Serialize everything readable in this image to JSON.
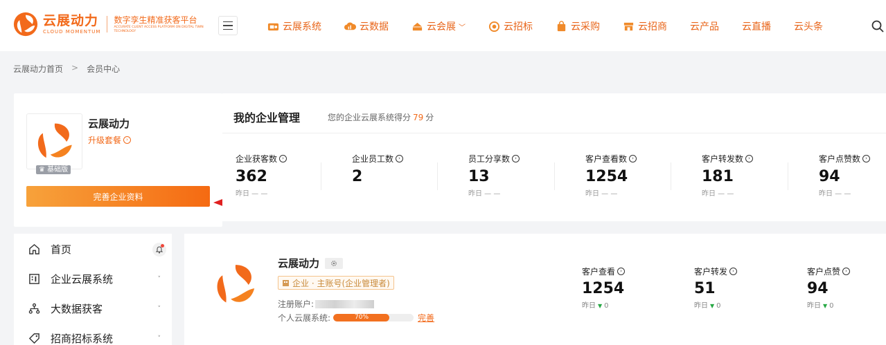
{
  "brand": {
    "name_cn": "云展动力",
    "name_en": "CLOUD MOMENTUM",
    "slogan_cn": "数字孪生精准获客平台",
    "slogan_en": "ACCURATE CLIENT ACCESS PLATFORM ON DIGITAL TWIN TECHNOLOGY",
    "accent": "#f26a1b"
  },
  "nav": {
    "items": [
      {
        "label": "云展系统",
        "icon": "cloud-system-icon"
      },
      {
        "label": "云数据",
        "icon": "cloud-data-icon"
      },
      {
        "label": "云会展",
        "icon": "exhibition-icon",
        "has_dropdown": true
      },
      {
        "label": "云招标",
        "icon": "bid-icon"
      },
      {
        "label": "云采购",
        "icon": "bag-icon"
      },
      {
        "label": "云招商",
        "icon": "shop-icon"
      },
      {
        "label": "云产品"
      },
      {
        "label": "云直播"
      },
      {
        "label": "云头条"
      }
    ]
  },
  "breadcrumb": {
    "home": "云展动力首页",
    "separator": ">",
    "current": "会员中心"
  },
  "profile": {
    "name": "云展动力",
    "upgrade": "升级套餐",
    "level_badge": "基础版",
    "complete_button": "完善企业资料"
  },
  "management": {
    "title": "我的企业管理",
    "score_prefix": "您的企业云展系统得分",
    "score": "79",
    "score_unit": "分",
    "stats": [
      {
        "label": "企业获客数",
        "value": "362",
        "sub": "昨日 — —"
      },
      {
        "label": "企业员工数",
        "value": "2",
        "sub": ""
      },
      {
        "label": "员工分享数",
        "value": "13",
        "sub": "昨日 — —"
      },
      {
        "label": "客户查看数",
        "value": "1254",
        "sub": "昨日 — —"
      },
      {
        "label": "客户转发数",
        "value": "181",
        "sub": "昨日 — —"
      },
      {
        "label": "客户点赞数",
        "value": "94",
        "sub": "昨日 — —"
      }
    ]
  },
  "side_menu": {
    "items": [
      {
        "label": "首页",
        "icon": "home-icon"
      },
      {
        "label": "企业云展系统",
        "icon": "building-icon"
      },
      {
        "label": "大数据获客",
        "icon": "network-icon"
      },
      {
        "label": "招商招标系统",
        "icon": "tag-icon"
      }
    ]
  },
  "enterprise": {
    "name": "云展动力",
    "role": "企业 · 主账号(企业管理者)",
    "account_label": "注册账户:",
    "system_label": "个人云展系统:",
    "progress": 0.7,
    "progress_text": "70%",
    "complete_link": "完善",
    "stats": [
      {
        "label": "客户查看",
        "value": "1254",
        "sub_prefix": "昨日",
        "sub_value": "0"
      },
      {
        "label": "客户转发",
        "value": "51",
        "sub_prefix": "昨日",
        "sub_value": "0"
      },
      {
        "label": "客户点赞",
        "value": "94",
        "sub_prefix": "昨日",
        "sub_value": "0"
      }
    ]
  }
}
